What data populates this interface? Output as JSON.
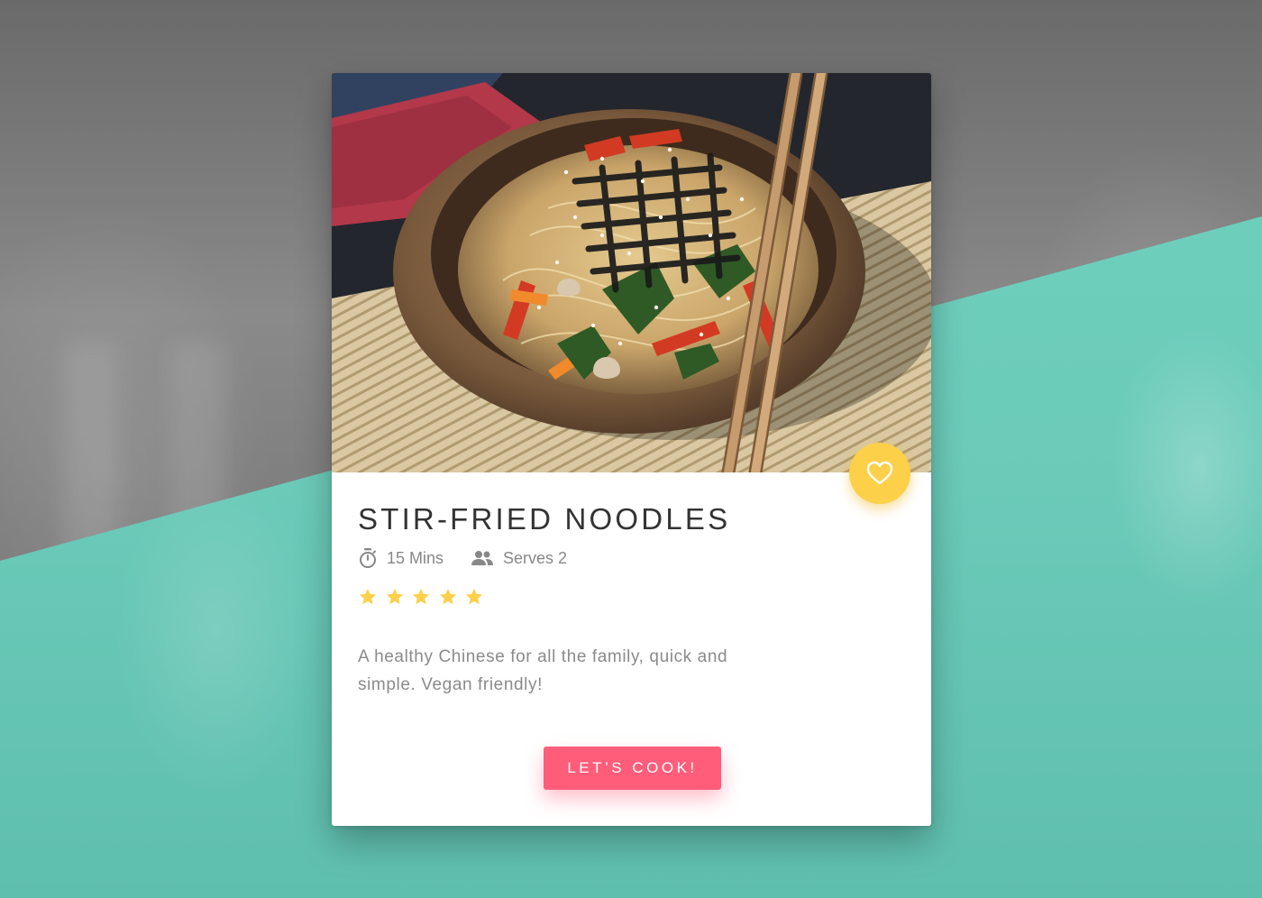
{
  "recipe": {
    "title": "STIR-FRIED NOODLES",
    "time": "15 Mins",
    "serves": "Serves 2",
    "rating": 5,
    "rating_max": 5,
    "description": "A healthy Chinese for all the family, quick and simple. Vegan friendly!",
    "cta_label": "LET’S COOK!"
  },
  "icons": {
    "favorite": "heart-icon",
    "time": "stopwatch-icon",
    "serves": "people-icon",
    "star": "star-icon"
  },
  "colors": {
    "accent_pink": "#ff5d7a",
    "favorite_yellow": "#fdd04a",
    "star_yellow": "#fdd04a",
    "title_text": "#333333",
    "meta_text": "#888888",
    "bg_teal": "#6ccbb9"
  }
}
